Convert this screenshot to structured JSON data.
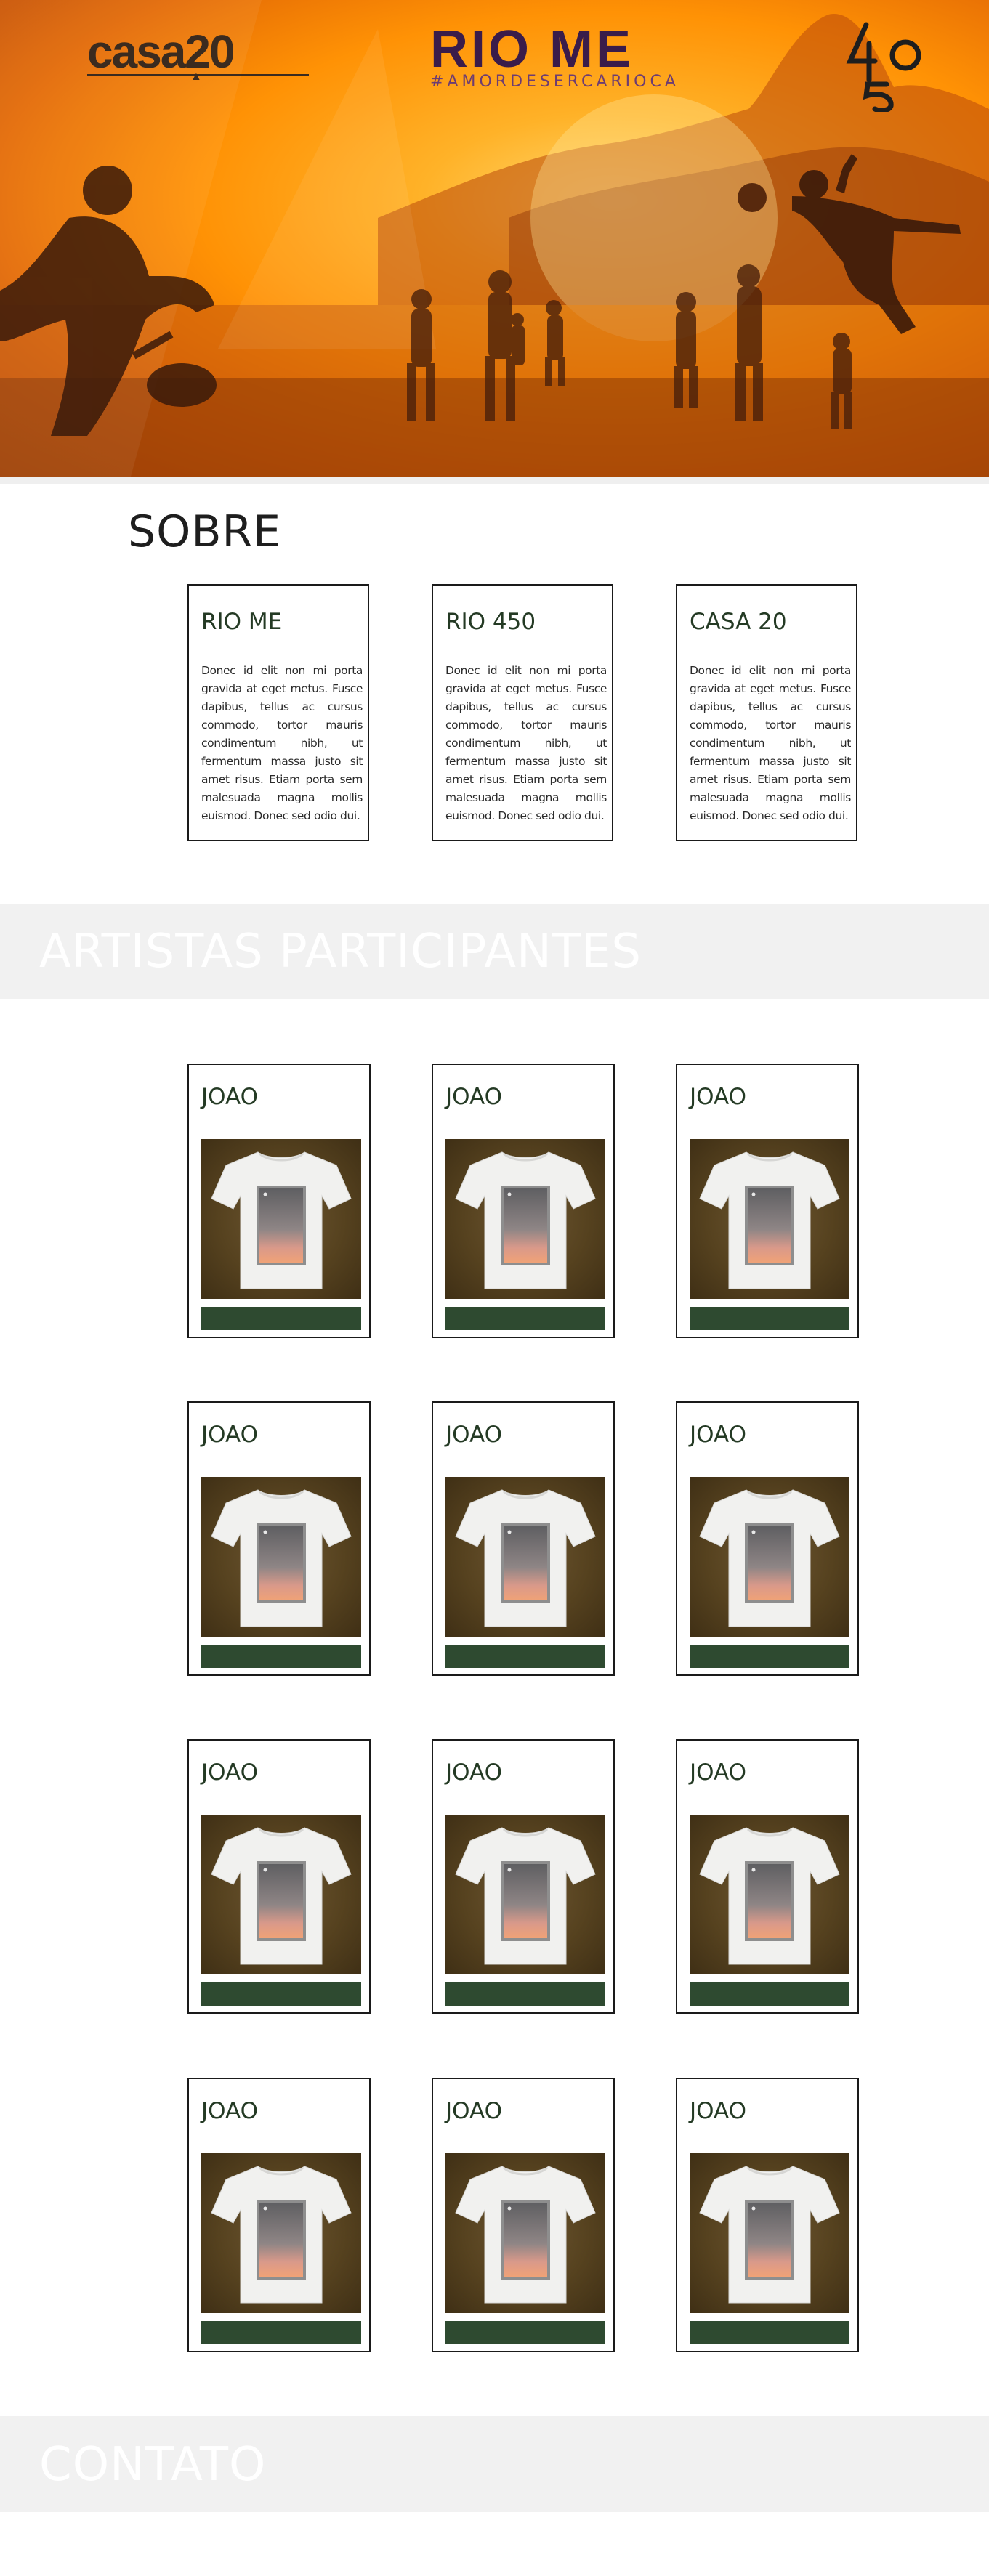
{
  "hero": {
    "brand_casa": "casa20",
    "brand_riome": "RIO ME",
    "hashtag": "#AMORDESERCARIOCA",
    "brand_450": "450"
  },
  "sobre": {
    "title": "SOBRE",
    "cards": [
      {
        "title": "RIO ME",
        "text": "Donec id elit non mi porta gravida at eget metus. Fusce dapibus, tellus ac cursus commodo, tortor mauris condimentum nibh, ut fermentum massa justo sit amet risus. Etiam porta sem malesuada magna mollis euismod. Donec sed odio dui."
      },
      {
        "title": "RIO 450",
        "text": "Donec id elit non mi porta gravida at eget metus. Fusce dapibus, tellus ac cursus commodo, tortor mauris condimentum nibh, ut fermentum massa justo sit amet risus. Etiam porta sem malesuada magna mollis euismod. Donec sed odio dui."
      },
      {
        "title": "CASA 20",
        "text": "Donec id elit non mi porta gravida at eget metus. Fusce dapibus, tellus ac cursus commodo, tortor mauris condimentum nibh, ut fermentum massa justo sit amet risus. Etiam porta sem malesuada magna mollis euismod. Donec sed odio dui."
      }
    ]
  },
  "artists": {
    "title": "ARTISTAS PARTICIPANTES",
    "items": [
      {
        "name": "JOAO"
      },
      {
        "name": "JOAO"
      },
      {
        "name": "JOAO"
      },
      {
        "name": "JOAO"
      },
      {
        "name": "JOAO"
      },
      {
        "name": "JOAO"
      },
      {
        "name": "JOAO"
      },
      {
        "name": "JOAO"
      },
      {
        "name": "JOAO"
      },
      {
        "name": "JOAO"
      },
      {
        "name": "JOAO"
      },
      {
        "name": "JOAO"
      }
    ]
  },
  "contato": {
    "title": "CONTATO"
  },
  "colors": {
    "hero_orange": "#ff9205",
    "card_title_green": "#243a24",
    "button_green": "#2e4a30",
    "band_gray": "#f1f1f1"
  }
}
